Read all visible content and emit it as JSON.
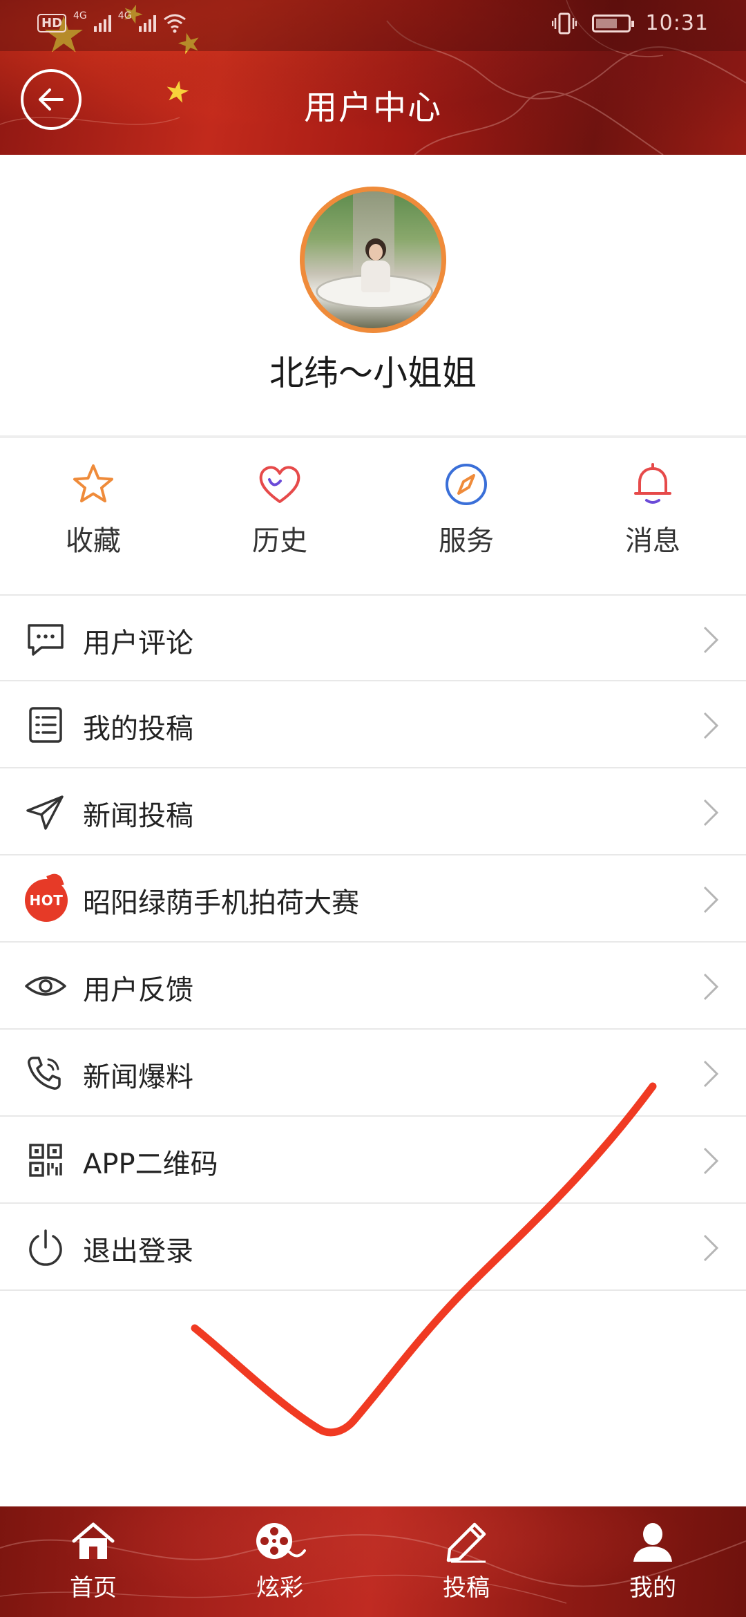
{
  "status_bar": {
    "hd": "HD",
    "net1": "4G",
    "net2": "4G",
    "time": "10:31"
  },
  "header": {
    "title": "用户中心"
  },
  "profile": {
    "nickname": "北纬～小姐姐"
  },
  "quick_actions": [
    {
      "label": "收藏",
      "icon": "star-icon",
      "color": "#ef8b3a"
    },
    {
      "label": "历史",
      "icon": "heart-icon",
      "color": "#e64a4a"
    },
    {
      "label": "服务",
      "icon": "compass-icon",
      "color": "#3a6fd8"
    },
    {
      "label": "消息",
      "icon": "bell-icon",
      "color": "#e64a4a"
    }
  ],
  "menu": [
    {
      "label": "用户评论",
      "icon": "comment-icon"
    },
    {
      "label": "我的投稿",
      "icon": "list-icon"
    },
    {
      "label": "新闻投稿",
      "icon": "paper-plane-icon"
    },
    {
      "label": "昭阳绿荫手机拍荷大赛",
      "icon": "hot-icon",
      "badge": "HOT"
    },
    {
      "label": "用户反馈",
      "icon": "eye-icon"
    },
    {
      "label": "新闻爆料",
      "icon": "phone-icon"
    },
    {
      "label": "APP二维码",
      "icon": "qr-code-icon"
    },
    {
      "label": "退出登录",
      "icon": "power-icon"
    }
  ],
  "bottom_nav": [
    {
      "label": "首页",
      "icon": "home-icon"
    },
    {
      "label": "炫彩",
      "icon": "film-reel-icon"
    },
    {
      "label": "投稿",
      "icon": "pencil-icon"
    },
    {
      "label": "我的",
      "icon": "user-icon"
    }
  ],
  "colors": {
    "header_red": "#b3231a",
    "accent_orange": "#ef8b3a",
    "check_stroke": "#f03a22"
  }
}
